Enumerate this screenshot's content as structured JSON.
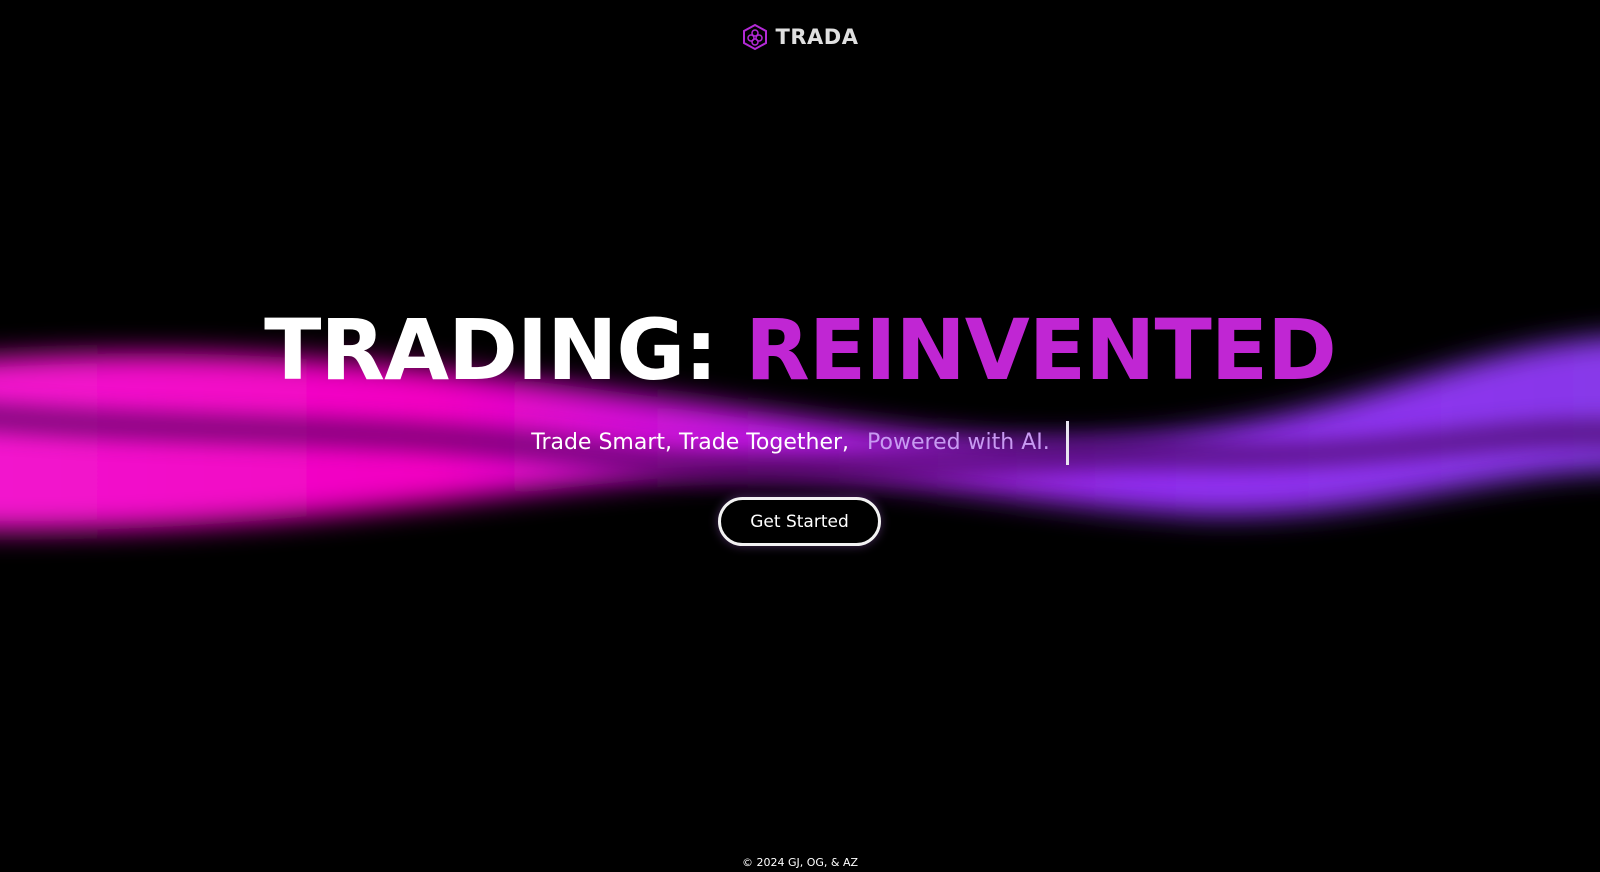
{
  "header": {
    "brand": "TRADA",
    "logo_icon": "hexagon-flower-icon"
  },
  "hero": {
    "title_part1": "TRADING:",
    "title_part2": "REINVENTED",
    "tagline_static": "Trade Smart, Trade Together,",
    "tagline_typed": "Powered with AI."
  },
  "cta": {
    "label": "Get Started"
  },
  "footer": {
    "copyright": "© 2024 GJ, OG, & AZ"
  },
  "colors": {
    "background": "#000000",
    "accent_magenta": "#ff00cc",
    "accent_purple": "#9b30ff",
    "title_purple": "#c026d3",
    "typed_text": "#c89af2"
  }
}
